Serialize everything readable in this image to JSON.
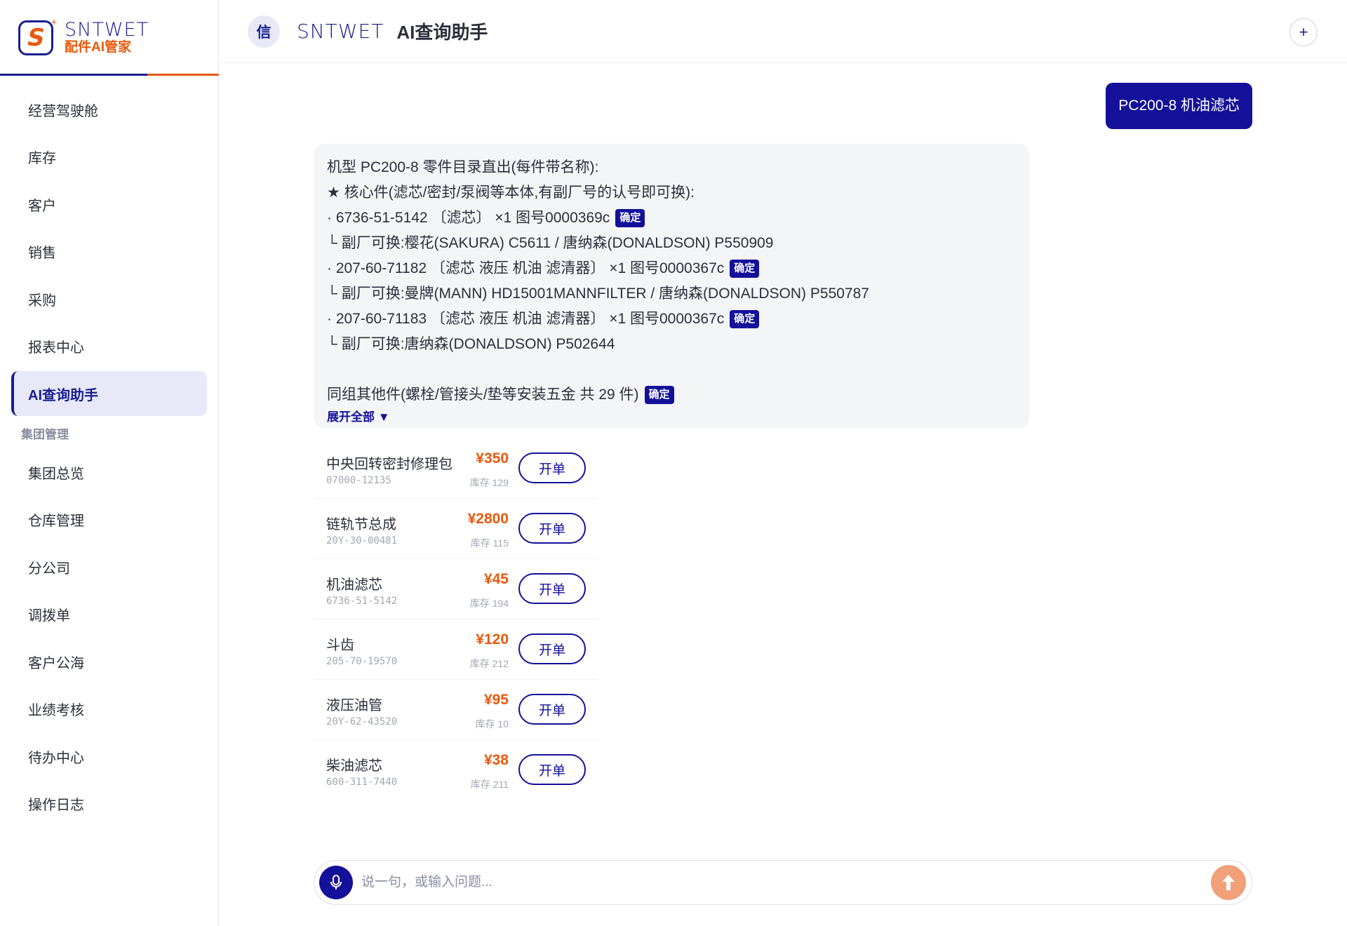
{
  "brand": {
    "name_en": "SNTWET",
    "name_cn": "配件AI管家"
  },
  "sidebar": {
    "items_top": [
      {
        "label": "经营驾驶舱"
      },
      {
        "label": "库存"
      },
      {
        "label": "客户"
      },
      {
        "label": "销售"
      },
      {
        "label": "采购"
      },
      {
        "label": "报表中心"
      },
      {
        "label": "AI查询助手",
        "active": true
      }
    ],
    "group_label": "集团管理",
    "items_group": [
      {
        "label": "集团总览"
      },
      {
        "label": "仓库管理"
      },
      {
        "label": "分公司"
      },
      {
        "label": "调拨单"
      },
      {
        "label": "客户公海"
      },
      {
        "label": "业绩考核"
      },
      {
        "label": "待办中心"
      },
      {
        "label": "操作日志"
      }
    ]
  },
  "header": {
    "avatar_text": "信",
    "logo_text": "SNTWET",
    "title": "AI查询助手",
    "new_chat_icon": "plus-icon"
  },
  "chat": {
    "user_message": "PC200-8 机油滤芯",
    "ai_lines": [
      "机型 PC200-8 零件目录直出(每件带名称):",
      "★ 核心件(滤芯/密封/泵阀等本体,有副厂号的认号即可换):",
      "· 6736-51-5142 〔滤芯〕 ×1 图号0000369c",
      "└ 副厂可换:樱花(SAKURA) C5611 / 唐纳森(DONALDSON) P550909",
      "· 207-60-71182 〔滤芯 液压 机油 滤清器〕 ×1 图号0000367c",
      "└ 副厂可换:曼牌(MANN) HD15001MANNFILTER / 唐纳森(DONALDSON) P550787",
      "· 207-60-71183 〔滤芯 液压 机油 滤清器〕 ×1 图号0000367c",
      "└ 副厂可换:唐纳森(DONALDSON) P502644",
      "",
      "同组其他件(螺栓/管接头/垫等安装五金 共 29 件)"
    ],
    "tag_label": "确定",
    "expand_label": "展开全部 ▼"
  },
  "products": [
    {
      "name": "中央回转密封修理包",
      "code": "07000-12135",
      "price": "¥350",
      "stock": "库存 129",
      "button": "开单"
    },
    {
      "name": "链轨节总成",
      "code": "20Y-30-00481",
      "price": "¥2800",
      "stock": "库存 115",
      "button": "开单"
    },
    {
      "name": "机油滤芯",
      "code": "6736-51-5142",
      "price": "¥45",
      "stock": "库存 194",
      "button": "开单"
    },
    {
      "name": "斗齿",
      "code": "205-70-19570",
      "price": "¥120",
      "stock": "库存 212",
      "button": "开单"
    },
    {
      "name": "液压油管",
      "code": "20Y-62-43520",
      "price": "¥95",
      "stock": "库存 10",
      "button": "开单"
    },
    {
      "name": "柴油滤芯",
      "code": "600-311-7440",
      "price": "¥38",
      "stock": "库存 211",
      "button": "开单"
    }
  ],
  "input": {
    "placeholder": "说一句，或输入问题...",
    "value": ""
  },
  "colors": {
    "primary": "#14109a",
    "accent": "#e8590c",
    "send_button": "#f2a07a"
  }
}
